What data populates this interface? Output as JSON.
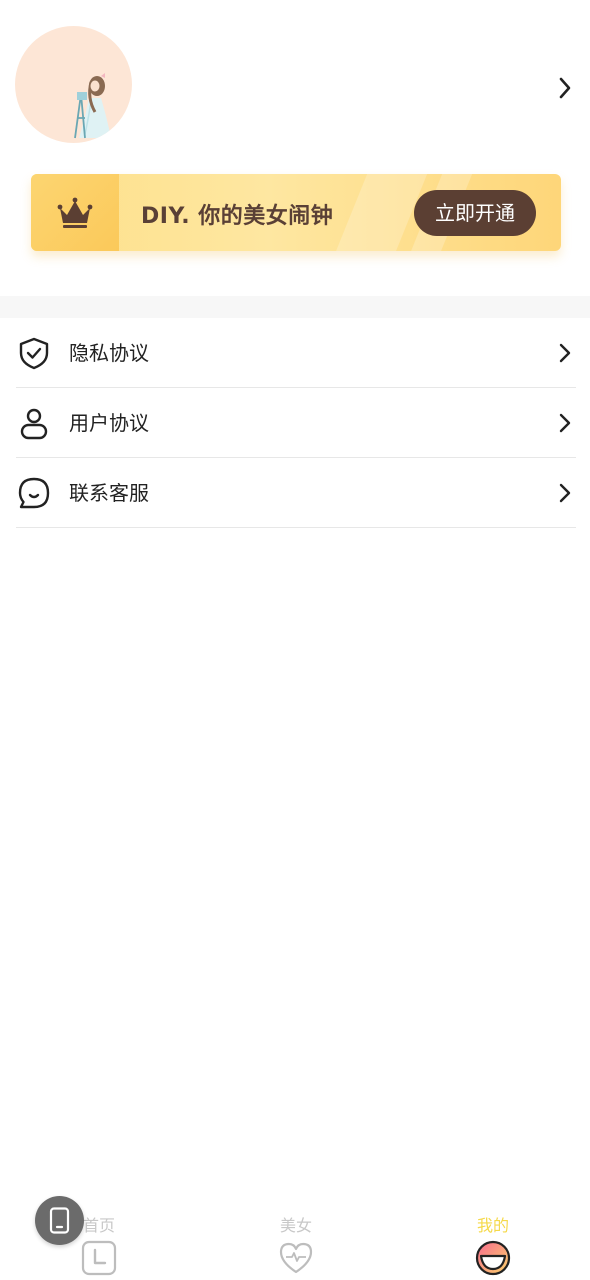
{
  "profile": {
    "avatar": "anime-girl-avatar",
    "chevron_icon": "chevron-right-icon"
  },
  "vip_banner": {
    "icon": "crown-icon",
    "text": "DIY. 你的美女闹钟",
    "button_label": "立即开通"
  },
  "menu": {
    "items": [
      {
        "label": "隐私协议",
        "icon": "shield-check-icon"
      },
      {
        "label": "用户协议",
        "icon": "user-icon"
      },
      {
        "label": "联系客服",
        "icon": "chat-bubble-icon"
      }
    ]
  },
  "tab_bar": {
    "tabs": [
      {
        "label": "首页",
        "icon": "clock-icon",
        "active": false
      },
      {
        "label": "美女",
        "icon": "heart-pulse-icon",
        "active": false
      },
      {
        "label": "我的",
        "icon": "smile-icon",
        "active": true
      }
    ]
  },
  "floating_button": {
    "icon": "phone-icon"
  },
  "colors": {
    "accent": "#f5d94a",
    "banner_button": "#5b3f33",
    "banner_text": "#5a4036",
    "inactive_tab": "#c8c8c8",
    "avatar_bg": "#fde6d6"
  }
}
